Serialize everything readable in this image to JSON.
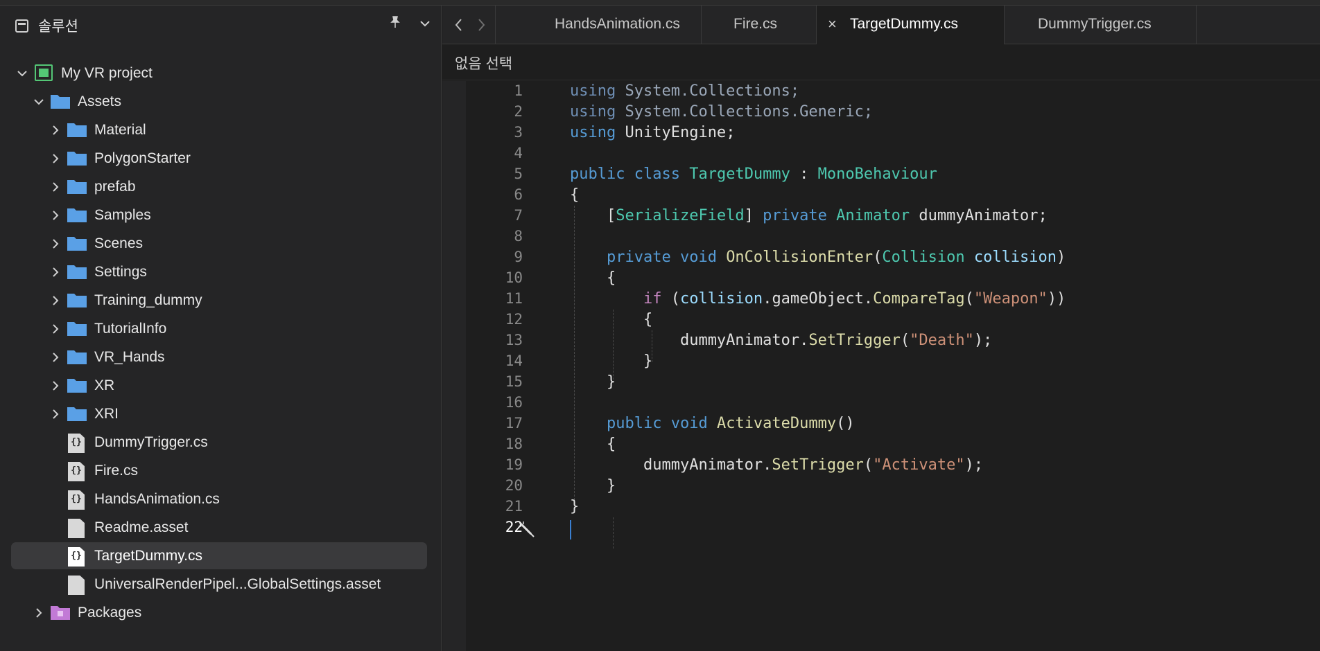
{
  "sidebar": {
    "title": "솔루션",
    "pin_icon": "pin-icon",
    "tree": [
      {
        "label": "My VR project",
        "kind": "project",
        "expanded": true
      },
      {
        "label": "Assets",
        "kind": "folder",
        "expanded": true
      },
      {
        "label": "Material",
        "kind": "folder"
      },
      {
        "label": "PolygonStarter",
        "kind": "folder"
      },
      {
        "label": "prefab",
        "kind": "folder"
      },
      {
        "label": "Samples",
        "kind": "folder"
      },
      {
        "label": "Scenes",
        "kind": "folder"
      },
      {
        "label": "Settings",
        "kind": "folder"
      },
      {
        "label": "Training_dummy",
        "kind": "folder"
      },
      {
        "label": "TutorialInfo",
        "kind": "folder"
      },
      {
        "label": "VR_Hands",
        "kind": "folder"
      },
      {
        "label": "XR",
        "kind": "folder"
      },
      {
        "label": "XRI",
        "kind": "folder"
      },
      {
        "label": "DummyTrigger.cs",
        "kind": "cs"
      },
      {
        "label": "Fire.cs",
        "kind": "cs"
      },
      {
        "label": "HandsAnimation.cs",
        "kind": "cs"
      },
      {
        "label": "Readme.asset",
        "kind": "file"
      },
      {
        "label": "TargetDummy.cs",
        "kind": "cs",
        "selected": true
      },
      {
        "label": "UniversalRenderPipel...GlobalSettings.asset",
        "kind": "file"
      },
      {
        "label": "Packages",
        "kind": "package"
      }
    ]
  },
  "tabs": [
    {
      "label": "HandsAnimation.cs",
      "active": false
    },
    {
      "label": "Fire.cs",
      "active": false
    },
    {
      "label": "TargetDummy.cs",
      "active": true
    },
    {
      "label": "DummyTrigger.cs",
      "active": false
    }
  ],
  "breadcrumb": "없음 선택",
  "editor": {
    "current_line": 22,
    "lines": [
      {
        "n": "1"
      },
      {
        "n": "2"
      },
      {
        "n": "3"
      },
      {
        "n": "4"
      },
      {
        "n": "5"
      },
      {
        "n": "6"
      },
      {
        "n": "7"
      },
      {
        "n": "8"
      },
      {
        "n": "9"
      },
      {
        "n": "10"
      },
      {
        "n": "11"
      },
      {
        "n": "12"
      },
      {
        "n": "13"
      },
      {
        "n": "14"
      },
      {
        "n": "15"
      },
      {
        "n": "16"
      },
      {
        "n": "17"
      },
      {
        "n": "18"
      },
      {
        "n": "19"
      },
      {
        "n": "20"
      },
      {
        "n": "21"
      },
      {
        "n": "22"
      }
    ],
    "tokens": {
      "using": "using",
      "system_collections": "System.Collections",
      "system_collections_generic": "System.Collections.Generic",
      "unityengine": "UnityEngine",
      "public": "public",
      "class": "class",
      "targetdummy": "TargetDummy",
      "monobehaviour": "MonoBehaviour",
      "serializefield": "SerializeField",
      "private": "private",
      "animator": "Animator",
      "dummyanimator": "dummyAnimator",
      "void": "void",
      "oncollisionenter": "OnCollisionEnter",
      "collision_type": "Collision",
      "collision_param": "collision",
      "if": "if",
      "gameobject": "gameObject",
      "comparetag": "CompareTag",
      "weapon": "\"Weapon\"",
      "settrigger": "SetTrigger",
      "death": "\"Death\"",
      "activatedummy": "ActivateDummy",
      "activate": "\"Activate\""
    }
  }
}
